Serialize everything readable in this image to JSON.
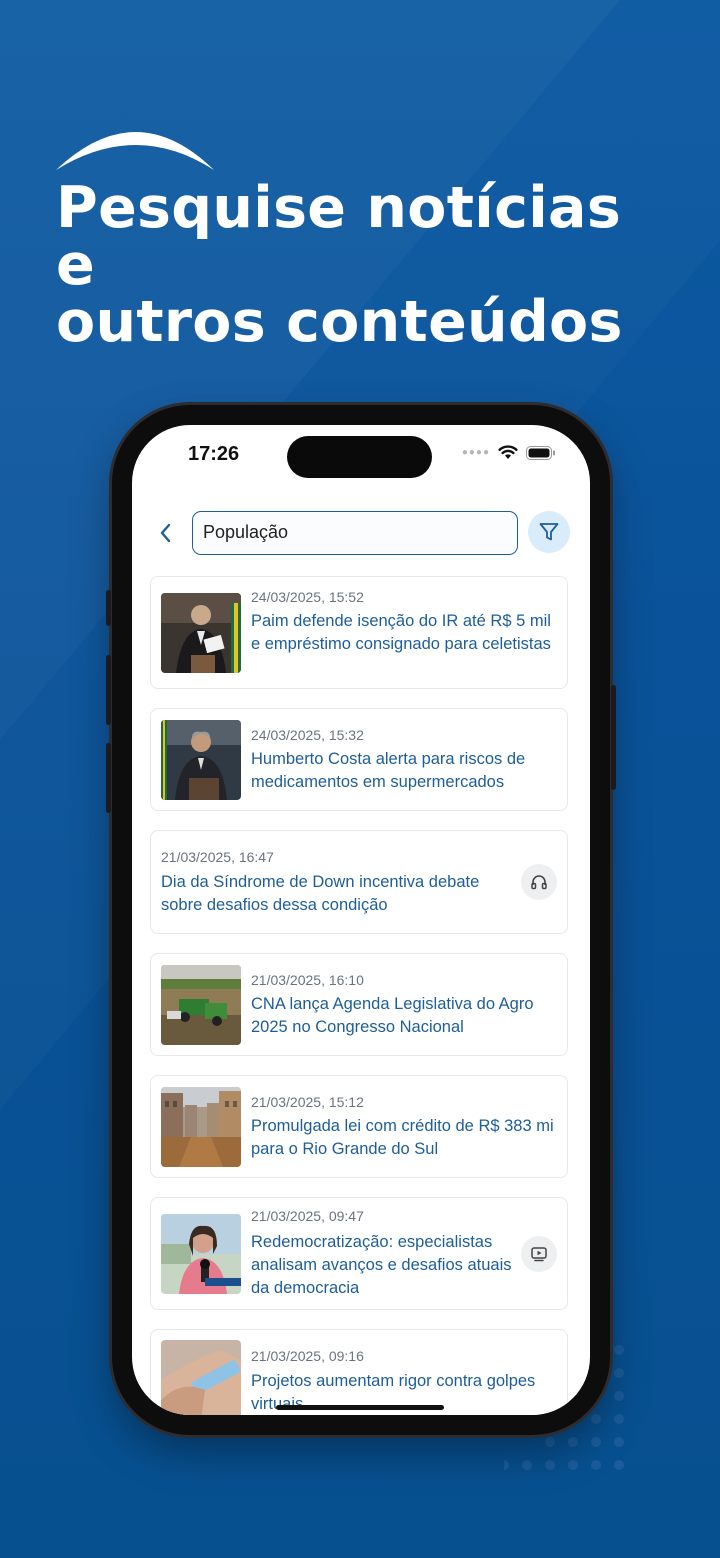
{
  "promo": {
    "headline_line1": "Pesquise notícias e",
    "headline_line2": "outros conteúdos"
  },
  "status_bar": {
    "time": "17:26"
  },
  "search": {
    "query": "População"
  },
  "results": [
    {
      "date": "24/03/2025, 15:52",
      "title": "Paim defende isenção do IR até R$ 5 mil e empréstimo consignado para celetistas",
      "thumb": "senator-speaking"
    },
    {
      "date": "24/03/2025, 15:32",
      "title": "Humberto Costa alerta para riscos de medicamentos em supermercados",
      "thumb": "senator-podium"
    },
    {
      "date": "21/03/2025, 16:47",
      "title": "Dia da Síndrome de Down incentiva debate sobre desafios dessa condição",
      "media": "headphones-icon"
    },
    {
      "date": "21/03/2025, 16:10",
      "title": "CNA lança Agenda Legislativa do Agro 2025 no Congresso Nacional",
      "thumb": "farm-harvest"
    },
    {
      "date": "21/03/2025, 15:12",
      "title": "Promulgada lei com crédito de R$ 383 mi para o Rio Grande do Sul",
      "thumb": "flooded-street"
    },
    {
      "date": "21/03/2025, 09:47",
      "title": "Redemocratização: especialistas analisam avanços e desafios atuais da democracia",
      "thumb": "interview",
      "media": "video-icon"
    },
    {
      "date": "21/03/2025, 09:16",
      "title": "Projetos aumentam rigor contra golpes virtuais",
      "thumb": "card-hands"
    }
  ],
  "colors": {
    "background": "#0a5299",
    "accent": "#1d5e98",
    "filter_bg": "#d9ecfb"
  }
}
